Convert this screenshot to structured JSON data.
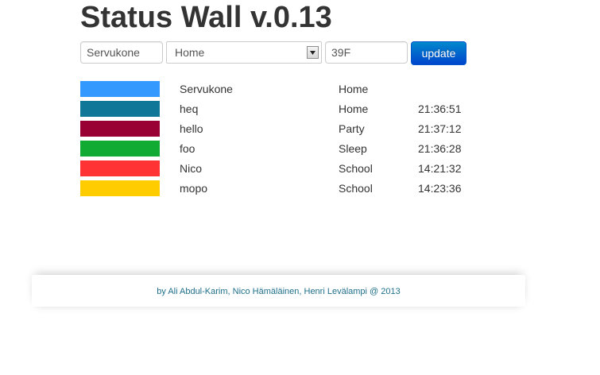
{
  "header": {
    "title": "Status Wall v.0.13"
  },
  "form": {
    "name_value": "Servukone",
    "status_selected": "Home",
    "code_value": "39F",
    "update_label": "update"
  },
  "statuses": [
    {
      "color": "#3399ff",
      "name": "Servukone",
      "status": "Home",
      "time": ""
    },
    {
      "color": "#117799",
      "name": "heq",
      "status": "Home",
      "time": "21:36:51"
    },
    {
      "color": "#990033",
      "name": "hello",
      "status": "Party",
      "time": "21:37:12"
    },
    {
      "color": "#11aa33",
      "name": "foo",
      "status": "Sleep",
      "time": "21:36:28"
    },
    {
      "color": "#ff3333",
      "name": "Nico",
      "status": "School",
      "time": "14:21:32"
    },
    {
      "color": "#ffcc00",
      "name": "mopo",
      "status": "School",
      "time": "14:23:36"
    }
  ],
  "footer": {
    "credits": "by Ali Abdul-Karim, Nico Hämäläinen, Henri Levälampi @ 2013"
  },
  "icons": {
    "select_arrow": "triangle-down-icon"
  },
  "colors": {
    "button_top": "#0088cc",
    "button_bottom": "#0044cc",
    "footer_text": "#1f6f8b"
  }
}
